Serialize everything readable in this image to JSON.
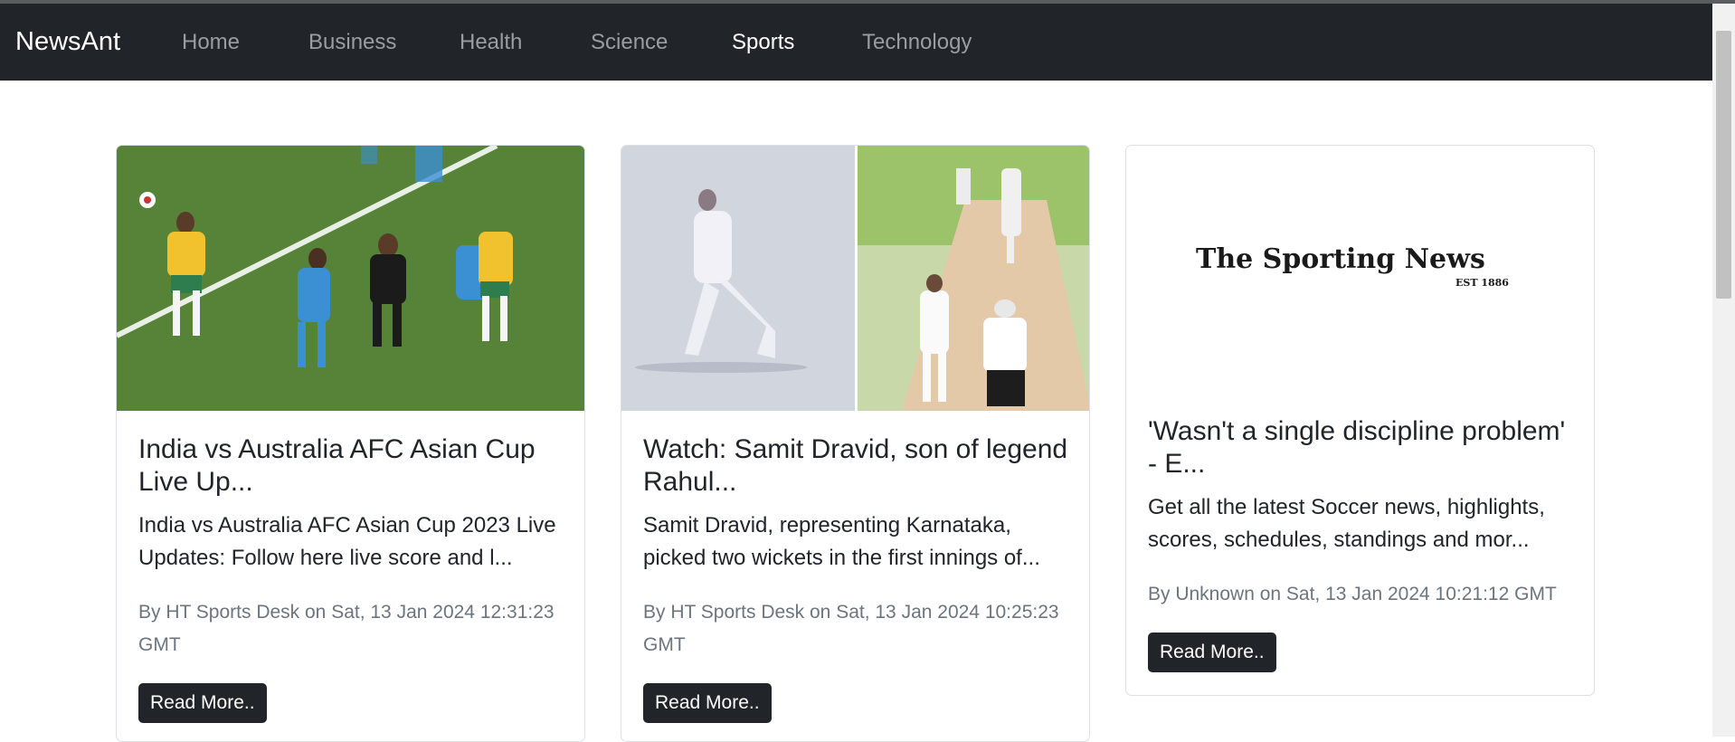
{
  "navbar": {
    "brand": "NewsAnt",
    "links": [
      {
        "label": "Home",
        "active": false
      },
      {
        "label": "Business",
        "active": false
      },
      {
        "label": "Health",
        "active": false
      },
      {
        "label": "Science",
        "active": false
      },
      {
        "label": "Sports",
        "active": true
      },
      {
        "label": "Technology",
        "active": false
      }
    ]
  },
  "cards": [
    {
      "image": "soccer-match-photo",
      "title": "India vs Australia AFC Asian Cup Live Up...",
      "description": "India vs Australia AFC Asian Cup 2023 Live Updates: Follow here live score and l...",
      "meta": "By HT Sports Desk on Sat, 13 Jan 2024 12:31:23 GMT",
      "button": "Read More.."
    },
    {
      "image": "cricket-bowler-photo",
      "title": "Watch: Samit Dravid, son of legend Rahul...",
      "description": "Samit Dravid, representing Karnataka, picked two wickets in the first innings of...",
      "meta": "By HT Sports Desk on Sat, 13 Jan 2024 10:25:23 GMT",
      "button": "Read More.."
    },
    {
      "image": "sporting-news-logo",
      "logo_text": "The Sporting News",
      "logo_subtext": "EST 1886",
      "title": "'Wasn't a single discipline problem' - E...",
      "description": "Get all the latest Soccer news, highlights, scores, schedules, standings and mor...",
      "meta": "By Unknown on Sat, 13 Jan 2024 10:21:12 GMT",
      "button": "Read More.."
    }
  ],
  "colors": {
    "navbar_bg": "#212529",
    "nav_active": "#ffffff",
    "nav_inactive": "#9a9da1",
    "button_bg": "#212529",
    "meta_text": "#6c757d"
  }
}
